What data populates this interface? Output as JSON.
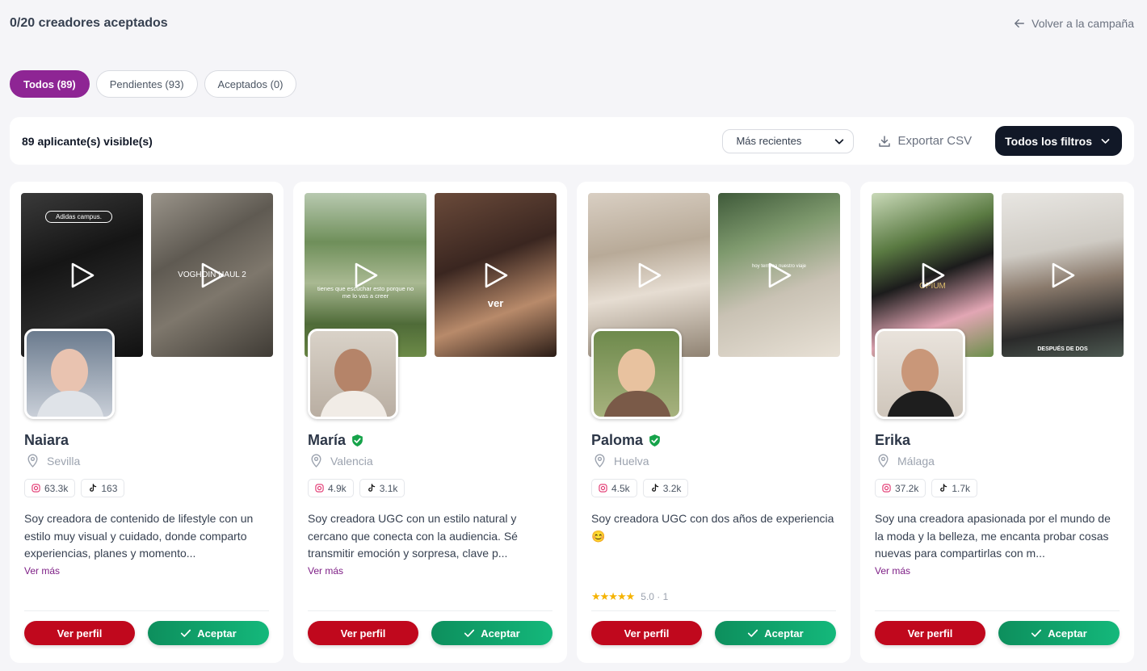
{
  "header": {
    "title": "0/20 creadores aceptados",
    "back_label": "Volver a la campaña"
  },
  "tabs": [
    {
      "label": "Todos (89)",
      "active": true
    },
    {
      "label": "Pendientes (93)",
      "active": false
    },
    {
      "label": "Aceptados (0)",
      "active": false
    }
  ],
  "toolbar": {
    "count_label": "89 aplicante(s) visible(s)",
    "sort_value": "Más recientes",
    "export_label": "Exportar CSV",
    "filters_label": "Todos los filtros"
  },
  "colors": {
    "brand": "#8e2594",
    "primary_button": "#c0081d",
    "accept_button": "#10a66c",
    "link": "#7e1f86",
    "verified": "#16a34a",
    "star": "#f5b301"
  },
  "cards": [
    {
      "name": "Naiara",
      "verified": false,
      "location": "Sevilla",
      "instagram": "63.3k",
      "tiktok": "163",
      "bio": "Soy creadora de contenido de lifestyle con un estilo muy visual y cuidado, donde comparto experiencias, planes y momento...",
      "more_label": "Ver más",
      "rating": "",
      "thumb_text_1": "Adidas campus.",
      "thumb_text_2": "VOGHOIN HAUL 2",
      "profile_label": "Ver perfil",
      "accept_label": "Aceptar"
    },
    {
      "name": "María",
      "verified": true,
      "location": "Valencia",
      "instagram": "4.9k",
      "tiktok": "3.1k",
      "bio": "Soy creadora UGC con un estilo natural y cercano que conecta con la audiencia. Sé transmitir emoción y sorpresa, clave p...",
      "more_label": "Ver más",
      "rating": "",
      "thumb_text_1": "tienes que escuchar esto porque no me lo vas a creer",
      "thumb_text_2": "ver",
      "profile_label": "Ver perfil",
      "accept_label": "Aceptar"
    },
    {
      "name": "Paloma",
      "verified": true,
      "location": "Huelva",
      "instagram": "4.5k",
      "tiktok": "3.2k",
      "bio": "Soy creadora UGC con dos años de experiencia 😊",
      "more_label": "",
      "rating": "5.0 · 1",
      "stars": "★★★★★",
      "thumb_text_1": "",
      "thumb_text_2": "hoy termina nuestro viaje",
      "profile_label": "Ver perfil",
      "accept_label": "Aceptar"
    },
    {
      "name": "Erika",
      "verified": false,
      "location": "Málaga",
      "instagram": "37.2k",
      "tiktok": "1.7k",
      "bio": "Soy una creadora apasionada por el mundo de la moda y la belleza, me encanta probar cosas nuevas para compartirlas con m...",
      "more_label": "Ver más",
      "rating": "",
      "thumb_text_1": "OPIUM",
      "thumb_text_2": "DESPUÉS DE DOS",
      "profile_label": "Ver perfil",
      "accept_label": "Aceptar"
    }
  ]
}
